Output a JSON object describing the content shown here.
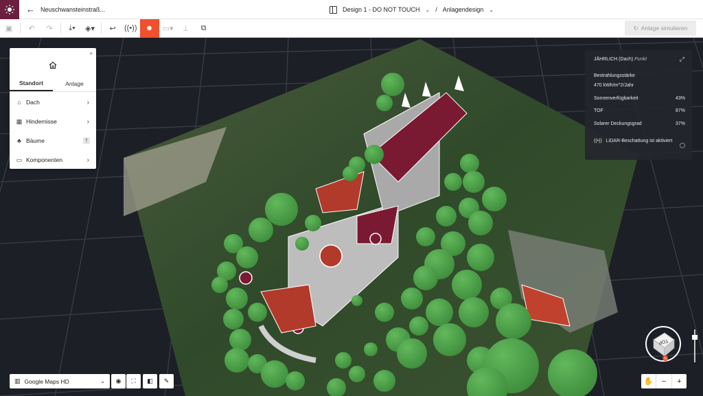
{
  "header": {
    "back_arrow": "←",
    "project_name": "Neuschwansteinstraß...",
    "design_name": "Design 1 - DO NOT TOUCH",
    "separator": "/",
    "view_name": "Anlagendesign"
  },
  "toolbar": {
    "simulate_label": "Anlage simulieren"
  },
  "left_panel": {
    "tabs": [
      "Standort",
      "Anlage"
    ],
    "items": [
      {
        "label": "Dach",
        "icon": "house-icon",
        "glyph": "⌂",
        "trailing": "›"
      },
      {
        "label": "Hindernisse",
        "icon": "grid-icon",
        "glyph": "▦",
        "trailing": "›"
      },
      {
        "label": "Bäume",
        "icon": "tree-icon",
        "glyph": "♣",
        "shortcut": "T"
      },
      {
        "label": "Komponenten",
        "icon": "component-icon",
        "glyph": "▭",
        "trailing": "›"
      }
    ]
  },
  "info_panel": {
    "period": "JÄHRLICH (Dach)",
    "mode": "Punkt",
    "irradiation_label": "Bestrahlungsstärke",
    "irradiation_value": "470 kWh/m^2/Jahr",
    "rows": [
      {
        "label": "Sonnenverfügbarkeit",
        "value": "43%"
      },
      {
        "label": "TOF",
        "value": "87%"
      },
      {
        "label": "Solarer Deckungsgrad",
        "value": "37%"
      }
    ],
    "lidar_text": "LiDAR-Beschattung ist aktiviert"
  },
  "bottom": {
    "map_source": "Google Maps HD",
    "compass_top": "TOP",
    "compass_n": "N",
    "zoom_minus": "−",
    "zoom_plus": "+"
  },
  "colors": {
    "brand": "#6b1f3f",
    "accent": "#f0502e",
    "tree": "#4ea04a",
    "roof": "#7a1a32"
  }
}
